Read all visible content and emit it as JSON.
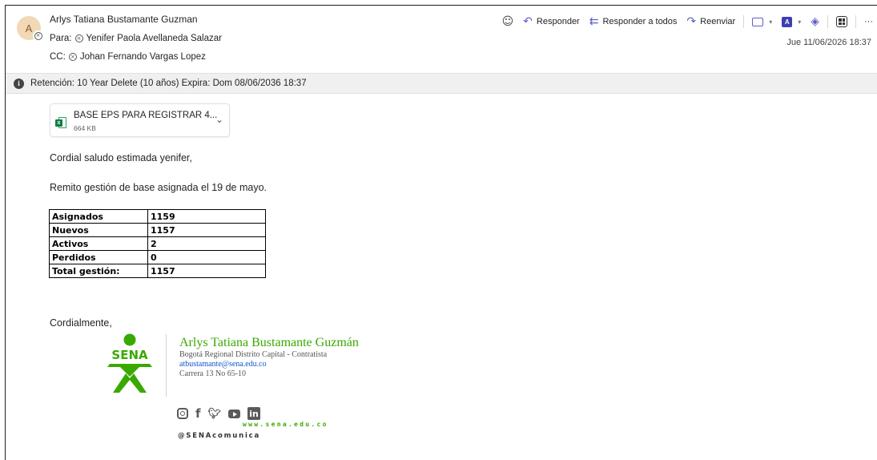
{
  "header": {
    "avatar_initial": "A",
    "sender": "Arlys Tatiana Bustamante Guzman",
    "to_label": "Para:",
    "to_name": "Yenifer Paola Avellaneda Salazar",
    "cc_label": "CC:",
    "cc_name": "Johan Fernando Vargas Lopez",
    "date": "Jue 11/06/2026 18:37"
  },
  "toolbar": {
    "reply": "Responder",
    "reply_all": "Responder a todos",
    "forward": "Reenviar",
    "more": "···"
  },
  "retention": {
    "text": "Retención: 10 Year Delete (10 años) Expira: Dom 08/06/2036 18:37"
  },
  "attachment": {
    "name": "BASE EPS PARA REGISTRAR 4...",
    "size": "664 KB"
  },
  "body": {
    "greeting": "Cordial saludo estimada yenifer,",
    "line1": "Remito gestión de base asignada el 19 de mayo.",
    "closing": "Cordialmente,",
    "table": [
      {
        "label": "Asignados",
        "value": "1159"
      },
      {
        "label": "Nuevos",
        "value": "1157"
      },
      {
        "label": "Activos",
        "value": "2"
      },
      {
        "label": "Perdidos",
        "value": "0"
      },
      {
        "label": "Total gestión:",
        "value": "1157"
      }
    ]
  },
  "signature": {
    "logo_text": "SENA",
    "name": "Arlys Tatiana Bustamante Guzmán",
    "role": "Bogotá Regional Distrito Capital - Contratista",
    "email": "atbustamante@sena.edu.co",
    "address": "Carrera 13 No 65-10",
    "website": "www.sena.edu.co",
    "handle": "@SENAcomunica",
    "colors": {
      "brand_green": "#39a900"
    }
  }
}
